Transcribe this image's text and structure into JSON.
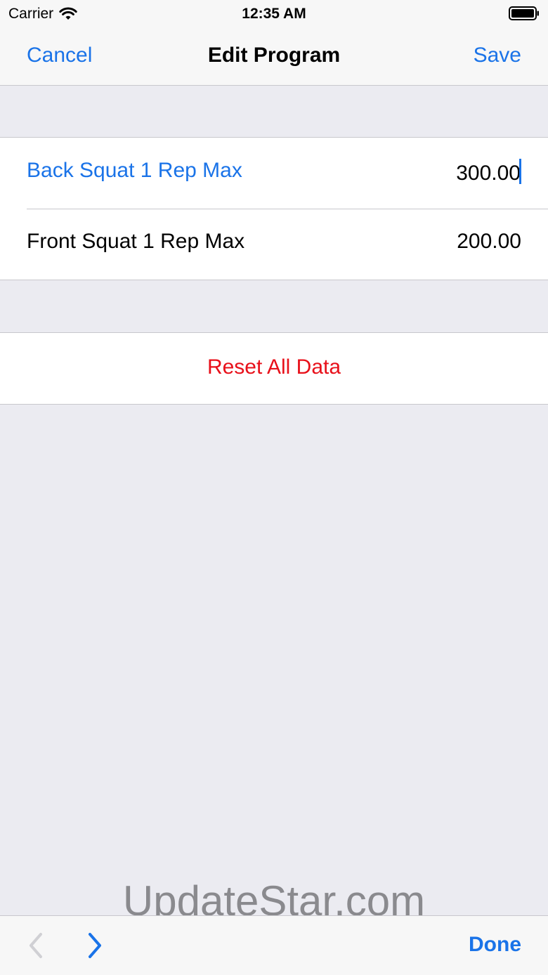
{
  "status_bar": {
    "carrier": "Carrier",
    "time": "12:35 AM"
  },
  "nav": {
    "cancel_label": "Cancel",
    "title": "Edit Program",
    "save_label": "Save"
  },
  "fields": [
    {
      "label": "Back Squat 1 Rep Max",
      "value": "300.00"
    },
    {
      "label": "Front Squat 1 Rep Max",
      "value": "200.00"
    }
  ],
  "reset": {
    "label": "Reset All Data"
  },
  "watermark": "UpdateStar.com",
  "toolbar": {
    "done_label": "Done"
  },
  "colors": {
    "accent": "#1a73e8",
    "destructive": "#e8101a",
    "background": "#ebebf1"
  },
  "icons": {
    "wifi": "wifi-icon",
    "battery": "battery-icon",
    "prev": "chevron-left-icon",
    "next": "chevron-right-icon"
  }
}
